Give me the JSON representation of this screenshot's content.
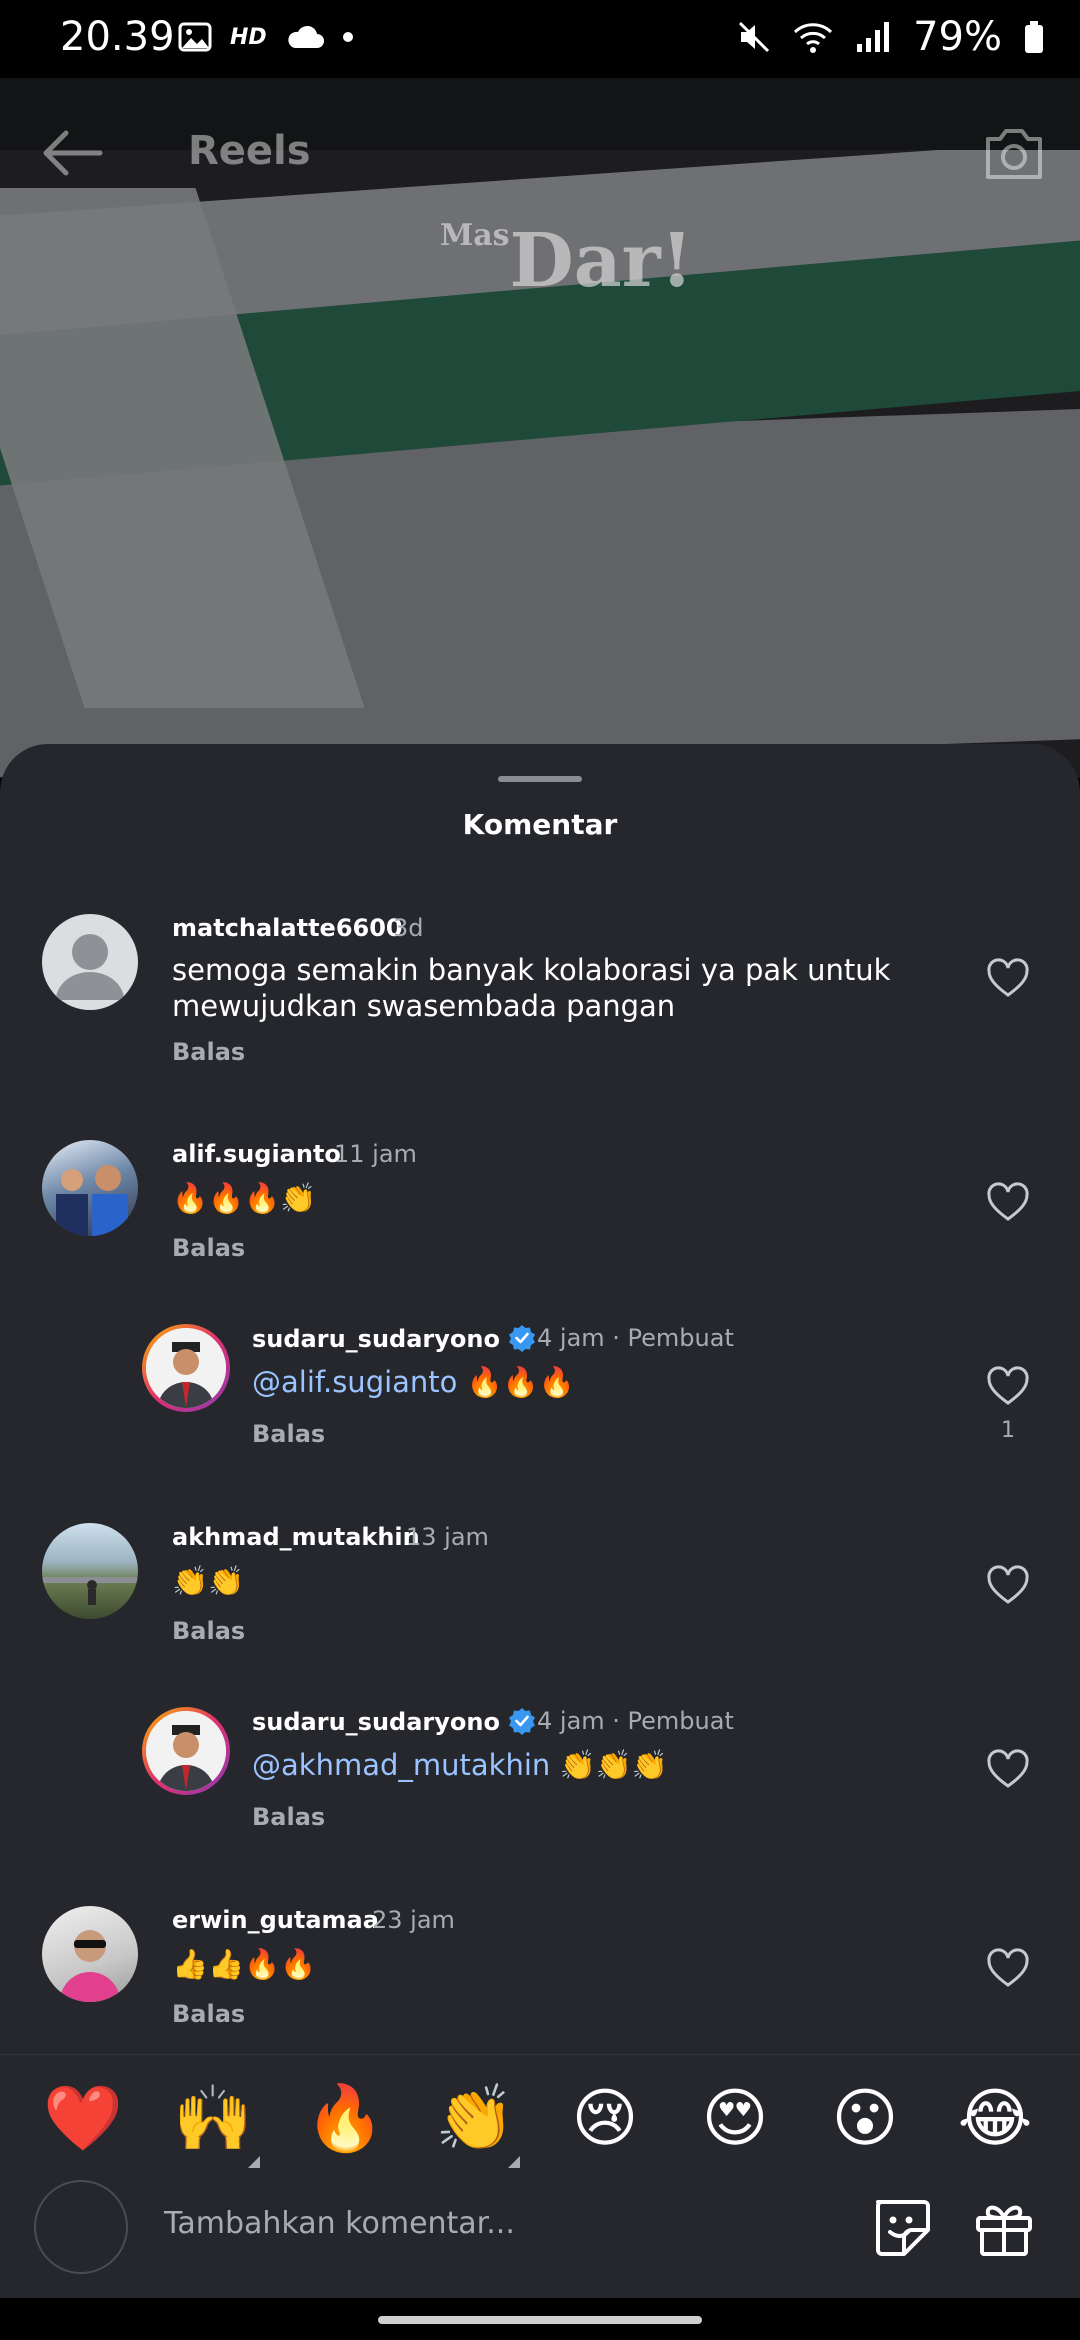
{
  "status_bar": {
    "time": "20.39",
    "hd": "HD",
    "battery": "79%"
  },
  "reels_header": {
    "title": "Reels"
  },
  "video": {
    "watermark_main": "Dar!",
    "watermark_small": "Mas"
  },
  "sheet": {
    "title": "Komentar"
  },
  "comments": [
    {
      "username": "matchalatte6600",
      "time": "3d",
      "text": "semoga semakin banyak kolaborasi ya pak untuk mewujudkan swasembada pangan",
      "reply": "Balas"
    },
    {
      "username": "alif.sugianto",
      "time": "11 jam",
      "text": "🔥🔥🔥👏",
      "reply": "Balas"
    },
    {
      "username": "sudaru_sudaryono",
      "time": "4 jam",
      "creator_label": "Pembuat",
      "mention": "@alif.sugianto",
      "text": " 🔥🔥🔥",
      "reply": "Balas",
      "likes": "1"
    },
    {
      "username": "akhmad_mutakhin",
      "time": "13 jam",
      "text": "👏👏",
      "reply": "Balas"
    },
    {
      "username": "sudaru_sudaryono",
      "time": "4 jam",
      "creator_label": "Pembuat",
      "mention": "@akhmad_mutakhin",
      "text": " 👏👏👏",
      "reply": "Balas"
    },
    {
      "username": "erwin_gutamaa",
      "time": "23 jam",
      "text": "👍👍🔥🔥",
      "reply": "Balas"
    }
  ],
  "emoji_bar": [
    "❤️",
    "🙌",
    "🔥",
    "👏",
    "😢",
    "😍",
    "😮",
    "😂"
  ],
  "input": {
    "placeholder": "Tambahkan komentar..."
  }
}
